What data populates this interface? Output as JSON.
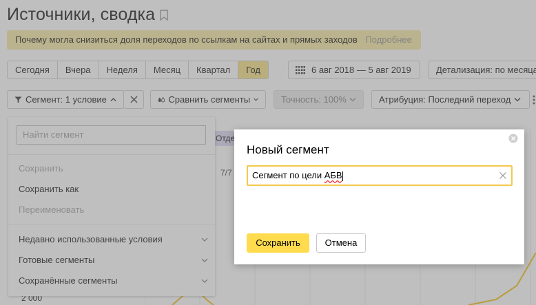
{
  "page": {
    "title": "Источники, сводка",
    "notice_text": "Почему могла снизиться доля переходов по ссылкам на сайтах и прямых заходов",
    "notice_link": "Подробнее"
  },
  "periods": [
    "Сегодня",
    "Вчера",
    "Неделя",
    "Месяц",
    "Квартал",
    "Год"
  ],
  "active_period": "Год",
  "toolbar": {
    "date_range": "6 авг 2018 — 5 авг 2019",
    "detail": "Детализация: по месяцам",
    "segment": "Сегмент: 1 условие",
    "compare": "Сравнить сегменты",
    "accuracy": "Точность: 100%",
    "attribution": "Атрибуция: Последний переход"
  },
  "background": {
    "tag": "Отде",
    "count": "7/7",
    "axis_value": "2 000"
  },
  "segment_menu": {
    "search_placeholder": "Найти сегмент",
    "save": "Сохранить",
    "save_as": "Сохранить как",
    "rename": "Переименовать",
    "recent": "Недавно использованные условия",
    "ready": "Готовые сегменты",
    "saved": "Сохранённые сегменты"
  },
  "modal": {
    "title": "Новый сегмент",
    "input_value_prefix": "Сегмент по цели ",
    "input_value_word": "АБВ",
    "save_label": "Сохранить",
    "cancel_label": "Отмена"
  },
  "colors": {
    "accent_yellow": "#ffdb4d",
    "active_period": "#f2dc78",
    "notice_bg": "#f4e69a",
    "chart_line": "#f2b705"
  }
}
